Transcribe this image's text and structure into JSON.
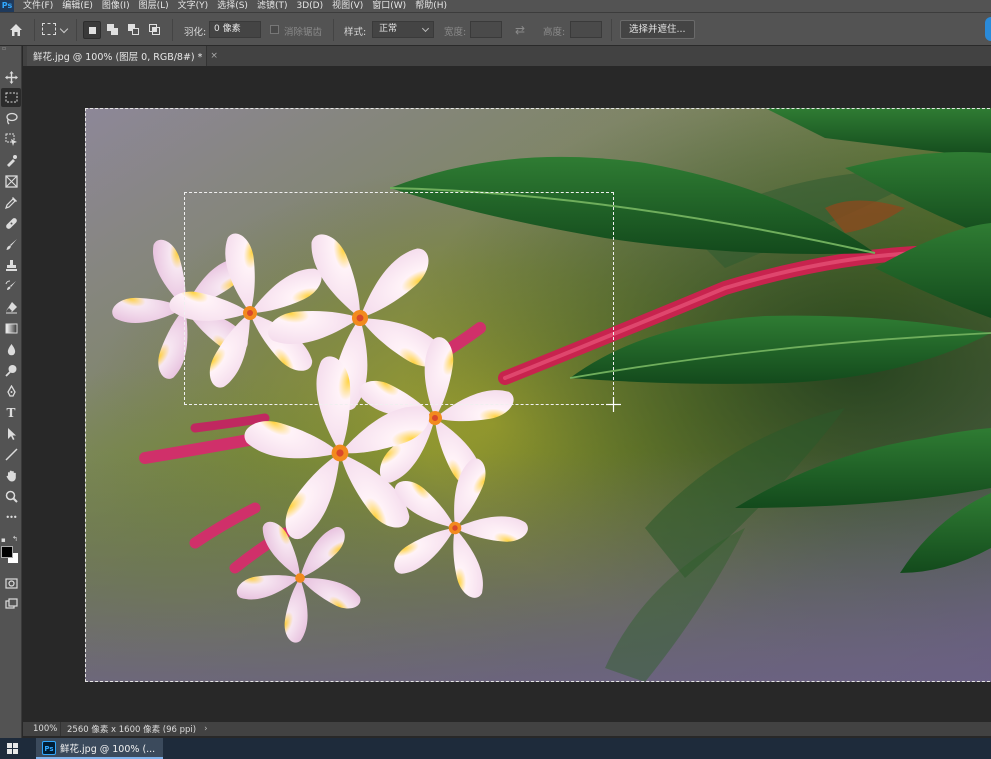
{
  "app": {
    "logo": "Ps"
  },
  "menubar": {
    "items": [
      "文件(F)",
      "编辑(E)",
      "图像(I)",
      "图层(L)",
      "文字(Y)",
      "选择(S)",
      "滤镜(T)",
      "3D(D)",
      "视图(V)",
      "窗口(W)",
      "帮助(H)"
    ]
  },
  "options": {
    "feather_label": "羽化:",
    "feather_value": "0 像素",
    "antialias_label": "消除锯齿",
    "style_label": "样式:",
    "style_value": "正常",
    "width_label": "宽度:",
    "height_label": "高度:",
    "select_mask_button": "选择并遮住..."
  },
  "document": {
    "tab_title": "鲜花.jpg @ 100% (图层 0, RGB/8#) *",
    "tab_close": "×"
  },
  "status": {
    "zoom": "100%",
    "info": "2560 像素 x 1600 像素 (96 ppi)",
    "arrow": "›"
  },
  "taskbar": {
    "app_icon": "Ps",
    "item_label": "鲜花.jpg @ 100% (..."
  },
  "toolbar": {
    "icons": [
      "move-icon",
      "rect-marquee-icon",
      "lasso-icon",
      "object-select-icon",
      "crop-icon",
      "frame-icon",
      "eyedropper-icon",
      "healing-icon",
      "brush-icon",
      "stamp-icon",
      "history-brush-icon",
      "eraser-icon",
      "gradient-icon",
      "blur-icon",
      "dodge-icon",
      "pen-icon",
      "type-icon",
      "path-select-icon",
      "line-icon",
      "hand-icon",
      "zoom-icon",
      "more-icon"
    ],
    "type_glyph": "T",
    "more_glyph": "•••"
  },
  "colors": {
    "foreground": "#000000",
    "background": "#ffffff",
    "accent": "#31a8ff"
  }
}
